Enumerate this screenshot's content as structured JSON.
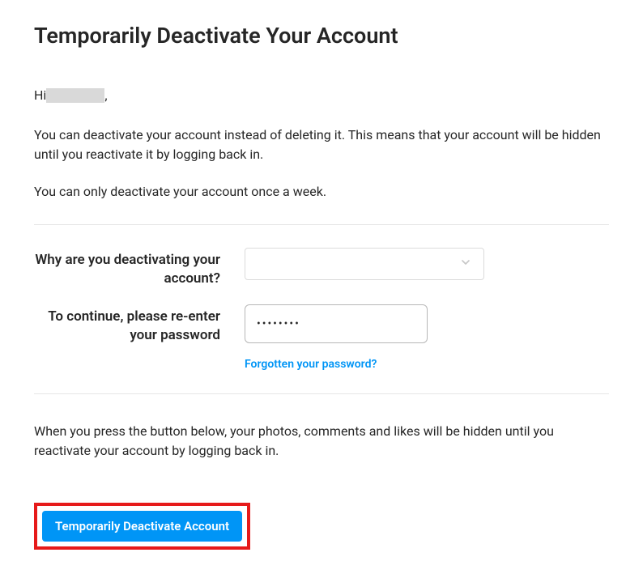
{
  "title": "Temporarily Deactivate Your Account",
  "greeting_prefix": "Hi ",
  "greeting_suffix": ",",
  "paragraph1": "You can deactivate your account instead of deleting it. This means that your account will be hidden until you reactivate it by logging back in.",
  "paragraph2": "You can only deactivate your account once a week.",
  "form": {
    "reason_label": "Why are you deactivating your account?",
    "reason_selected": "",
    "password_label": "To continue, please re-enter your password",
    "password_value": "••••••••",
    "forgot_link": "Forgotten your password?"
  },
  "paragraph3": "When you press the button below, your photos, comments and likes will be hidden until you reactivate your account by logging back in.",
  "button_label": "Temporarily Deactivate Account"
}
